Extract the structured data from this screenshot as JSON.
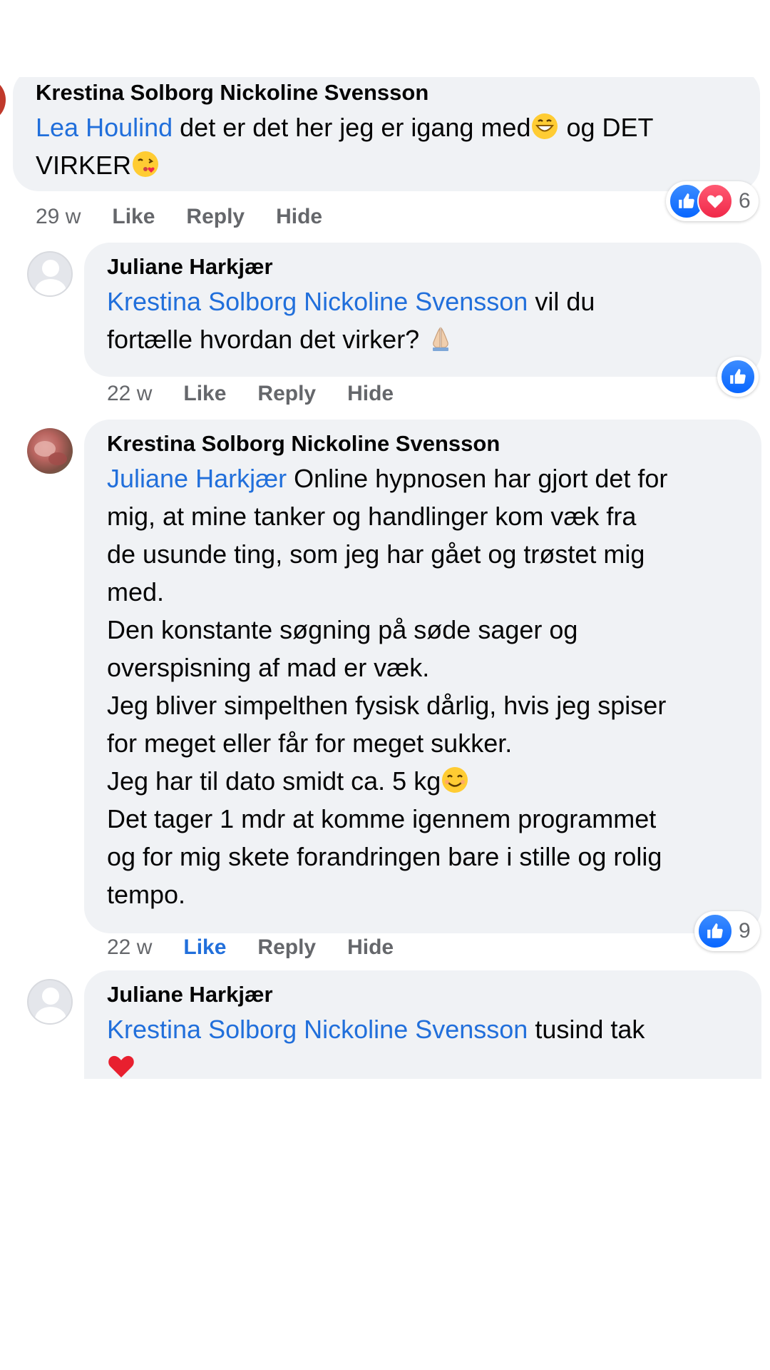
{
  "comments": [
    {
      "author": "Krestina Solborg Nickoline Svensson",
      "mention": "Lea Houlind",
      "line1": " det er det her jeg er igang med",
      "line1b": " og DET",
      "line2": "VIRKER",
      "time": "29 w",
      "like": "Like",
      "reply": "Reply",
      "hide": "Hide",
      "reaction_count": "6",
      "reactions": [
        "like",
        "love"
      ]
    },
    {
      "author": "Juliane Harkjær",
      "mention": "Krestina Solborg Nickoline Svensson",
      "line1": " vil du",
      "line2": "fortælle hvordan det virker? ",
      "time": "22 w",
      "like": "Like",
      "reply": "Reply",
      "hide": "Hide",
      "reactions": [
        "like"
      ]
    },
    {
      "author": "Krestina Solborg Nickoline Svensson",
      "mention": "Juliane Harkjær",
      "first_line": " Online hypnosen har gjort det for",
      "lines": [
        "mig, at mine tanker og handlinger kom væk fra",
        "de usunde ting, som jeg har gået og trøstet mig",
        "med.",
        "Den konstante søgning på søde sager og",
        "overspisning af mad er væk.",
        "Jeg bliver simpelthen fysisk dårlig, hvis jeg spiser",
        "for meget eller får for meget sukker.",
        "Jeg har til dato smidt ca. 5 kg",
        "Det tager 1 mdr at komme igennem programmet",
        "og for mig skete forandringen bare i stille og rolig",
        "tempo."
      ],
      "time": "22 w",
      "like": "Like",
      "reply": "Reply",
      "hide": "Hide",
      "reaction_count": "9",
      "reactions": [
        "like"
      ]
    },
    {
      "author": "Juliane Harkjær",
      "mention": "Krestina Solborg Nickoline Svensson",
      "line1": " tusind tak"
    }
  ],
  "colors": {
    "mention": "#216fdb",
    "bubble": "#f0f2f5",
    "meta": "#65676b",
    "like_active": "#216fdb"
  }
}
